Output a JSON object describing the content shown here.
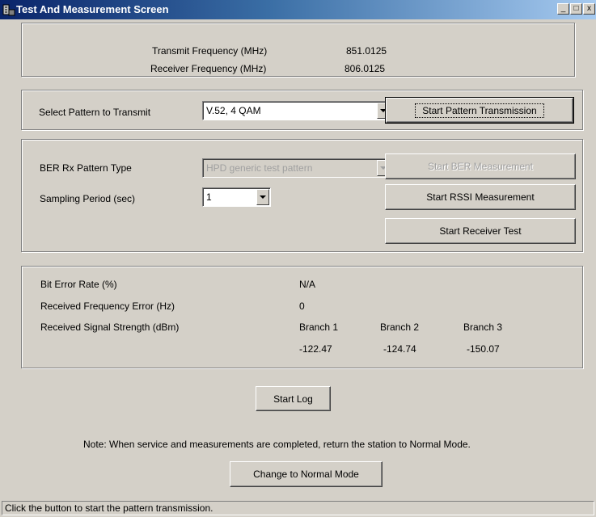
{
  "window": {
    "title": "Test And Measurement Screen",
    "buttons": {
      "minimize": "_",
      "maximize": "□",
      "close": "x"
    }
  },
  "frequencies": {
    "transmit_label": "Transmit Frequency (MHz)",
    "transmit_value": "851.0125",
    "receiver_label": "Receiver Frequency (MHz)",
    "receiver_value": "806.0125"
  },
  "pattern": {
    "label": "Select Pattern to Transmit",
    "selected": "V.52, 4 QAM",
    "button": "Start Pattern Transmission"
  },
  "ber_config": {
    "pattern_type_label": "BER Rx Pattern Type",
    "pattern_type_value": "HPD generic test pattern",
    "sampling_label": "Sampling Period (sec)",
    "sampling_value": "1",
    "start_ber_button": "Start BER Measurement",
    "start_rssi_button": "Start RSSI Measurement",
    "start_receiver_button": "Start Receiver Test"
  },
  "results": {
    "ber_label": "Bit Error Rate (%)",
    "ber_value": "N/A",
    "freq_error_label": "Received Frequency Error (Hz)",
    "freq_error_value": "0",
    "rssi_label": "Received Signal Strength (dBm)",
    "branches": [
      {
        "name": "Branch 1",
        "value": "-122.47"
      },
      {
        "name": "Branch 2",
        "value": "-124.74"
      },
      {
        "name": "Branch 3",
        "value": "-150.07"
      }
    ]
  },
  "log": {
    "start_button": "Start Log"
  },
  "note": "Note: When service and measurements are completed, return the station to Normal Mode.",
  "normal_mode_button": "Change to Normal Mode",
  "status": "Click the button to start the pattern transmission.",
  "colors": {
    "face": "#d4d0c8",
    "title_start": "#0a246a",
    "title_end": "#a6caf0"
  }
}
